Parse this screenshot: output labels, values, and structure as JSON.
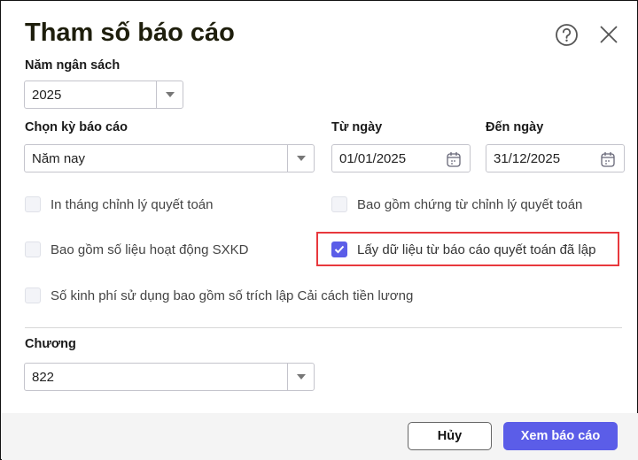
{
  "dialog": {
    "title": "Tham số báo cáo",
    "help_icon": "help-circle-icon",
    "close_icon": "close-icon",
    "budget_year": {
      "label": "Năm ngân sách",
      "value": "2025"
    },
    "period": {
      "label": "Chọn kỳ báo cáo",
      "value": "Năm nay"
    },
    "from_date": {
      "label": "Từ ngày",
      "value": "01/01/2025"
    },
    "to_date": {
      "label": "Đến ngày",
      "value": "31/12/2025"
    },
    "options": [
      {
        "label": "In tháng chỉnh lý quyết toán",
        "checked": false
      },
      {
        "label": "Bao gồm chứng từ chỉnh lý quyết toán",
        "checked": false
      },
      {
        "label": "Bao gồm số liệu hoạt động SXKD",
        "checked": false
      },
      {
        "label": "Lấy dữ liệu từ báo cáo quyết toán đã lập",
        "checked": true
      },
      {
        "label": "Số kinh phí sử dụng bao gồm số trích lập Cải cách tiền lương",
        "checked": false
      }
    ],
    "chapter": {
      "label": "Chương",
      "value": "822"
    },
    "cancel_label": "Hủy",
    "submit_label": "Xem báo cáo",
    "colors": {
      "accent": "#5b5de8",
      "highlight": "#e8383d"
    }
  }
}
